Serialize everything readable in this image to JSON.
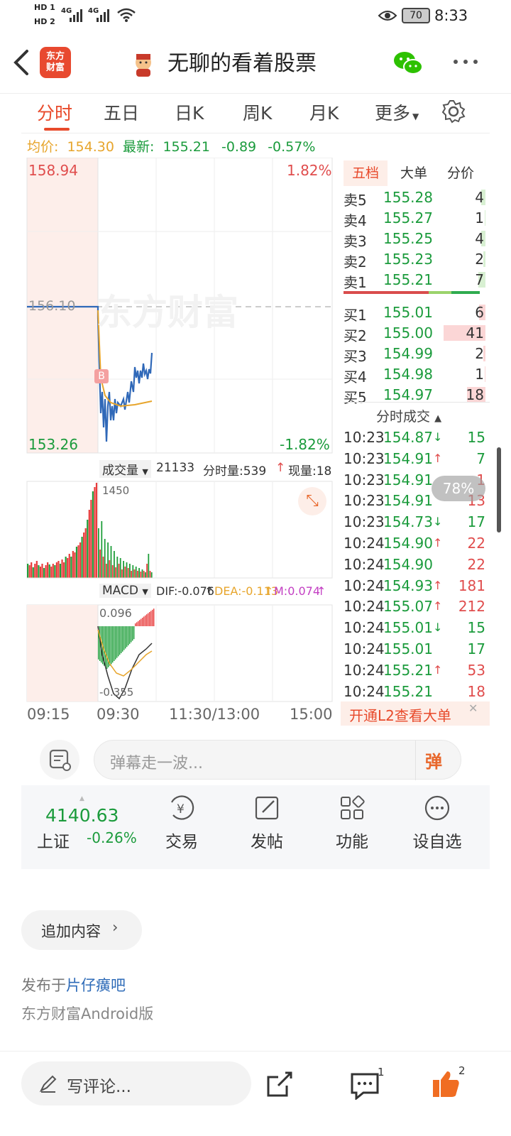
{
  "status": {
    "time": "8:33",
    "battery": "70",
    "sim1": "HD 1",
    "sim2": "HD 2",
    "net1": "4G",
    "net2": "4G"
  },
  "header": {
    "brand": "东方\n财富",
    "title": "无聊的看着股票"
  },
  "tabs": [
    "分时",
    "五日",
    "日K",
    "周K",
    "月K",
    "更多"
  ],
  "quote": {
    "avg_label": "均价:",
    "avg": "154.30",
    "latest_label": "最新:",
    "latest": "155.21",
    "change": "-0.89",
    "change_pct": "-0.57%"
  },
  "chart": {
    "watermark": "东方财富",
    "high": "158.94",
    "low": "153.26",
    "high_pct": "1.82%",
    "low_pct": "-1.82%",
    "prev_close": "156.10",
    "buy_marker": "B",
    "volume_label": "成交量",
    "volume_total": "21133",
    "tick_volume": "分时量:539",
    "current_volume": "现量:18",
    "volume_max": "1450",
    "macd_label": "MACD",
    "dif": "DIF:-0.076",
    "dea": "DEA:-0.113",
    "m": "M:0.074",
    "macd_top": "0.096",
    "macd_bottom": "-0.355",
    "x_labels": [
      "09:15",
      "09:30",
      "11:30/13:00",
      "15:00"
    ],
    "zoom_badge": "78%"
  },
  "orderbook": {
    "tabs": [
      "五档",
      "大单",
      "分价"
    ],
    "asks": [
      {
        "label": "卖5",
        "price": "155.28",
        "qty": "4"
      },
      {
        "label": "卖4",
        "price": "155.27",
        "qty": "1"
      },
      {
        "label": "卖3",
        "price": "155.25",
        "qty": "4"
      },
      {
        "label": "卖2",
        "price": "155.23",
        "qty": "2"
      },
      {
        "label": "卖1",
        "price": "155.21",
        "qty": "7"
      }
    ],
    "bids": [
      {
        "label": "买1",
        "price": "155.01",
        "qty": "6"
      },
      {
        "label": "买2",
        "price": "155.00",
        "qty": "41"
      },
      {
        "label": "买3",
        "price": "154.99",
        "qty": "2"
      },
      {
        "label": "买4",
        "price": "154.98",
        "qty": "1"
      },
      {
        "label": "买5",
        "price": "154.97",
        "qty": "18"
      }
    ],
    "trades_title": "分时成交",
    "trades": [
      {
        "time": "10:23",
        "price": "154.87",
        "dir": "↓",
        "qty": "15",
        "qc": "green"
      },
      {
        "time": "10:23",
        "price": "154.91",
        "dir": "↑",
        "qty": "7",
        "qc": "green"
      },
      {
        "time": "10:23",
        "price": "154.91",
        "dir": "",
        "qty": "1",
        "qc": "red"
      },
      {
        "time": "10:23",
        "price": "154.91",
        "dir": "",
        "qty": "13",
        "qc": "red"
      },
      {
        "time": "10:23",
        "price": "154.73",
        "dir": "↓",
        "qty": "17",
        "qc": "green"
      },
      {
        "time": "10:24",
        "price": "154.90",
        "dir": "↑",
        "qty": "22",
        "qc": "red"
      },
      {
        "time": "10:24",
        "price": "154.90",
        "dir": "",
        "qty": "22",
        "qc": "red"
      },
      {
        "time": "10:24",
        "price": "154.93",
        "dir": "↑",
        "qty": "181",
        "qc": "red"
      },
      {
        "time": "10:24",
        "price": "155.07",
        "dir": "↑",
        "qty": "212",
        "qc": "red"
      },
      {
        "time": "10:24",
        "price": "155.01",
        "dir": "↓",
        "qty": "15",
        "qc": "green"
      },
      {
        "time": "10:24",
        "price": "155.01",
        "dir": "",
        "qty": "17",
        "qc": "green"
      },
      {
        "time": "10:24",
        "price": "155.21",
        "dir": "↑",
        "qty": "53",
        "qc": "red"
      },
      {
        "time": "10:24",
        "price": "155.21",
        "dir": "",
        "qty": "18",
        "qc": "red"
      }
    ],
    "l2_banner": "开通L2查看大单"
  },
  "comment": {
    "placeholder": "弹幕走一波...",
    "danmu": "弹"
  },
  "toolbar": {
    "index_value": "4140.63",
    "index_name": "上证",
    "index_change": "-0.26%",
    "trade": "交易",
    "post": "发帖",
    "func": "功能",
    "watch": "设自选"
  },
  "post": {
    "add_content": "追加内容",
    "published_prefix": "发布于",
    "forum": "片仔癀吧",
    "client": "东方财富Android版"
  },
  "bottom": {
    "write_comment": "写评论...",
    "comment_count": "1",
    "like_count": "2"
  }
}
